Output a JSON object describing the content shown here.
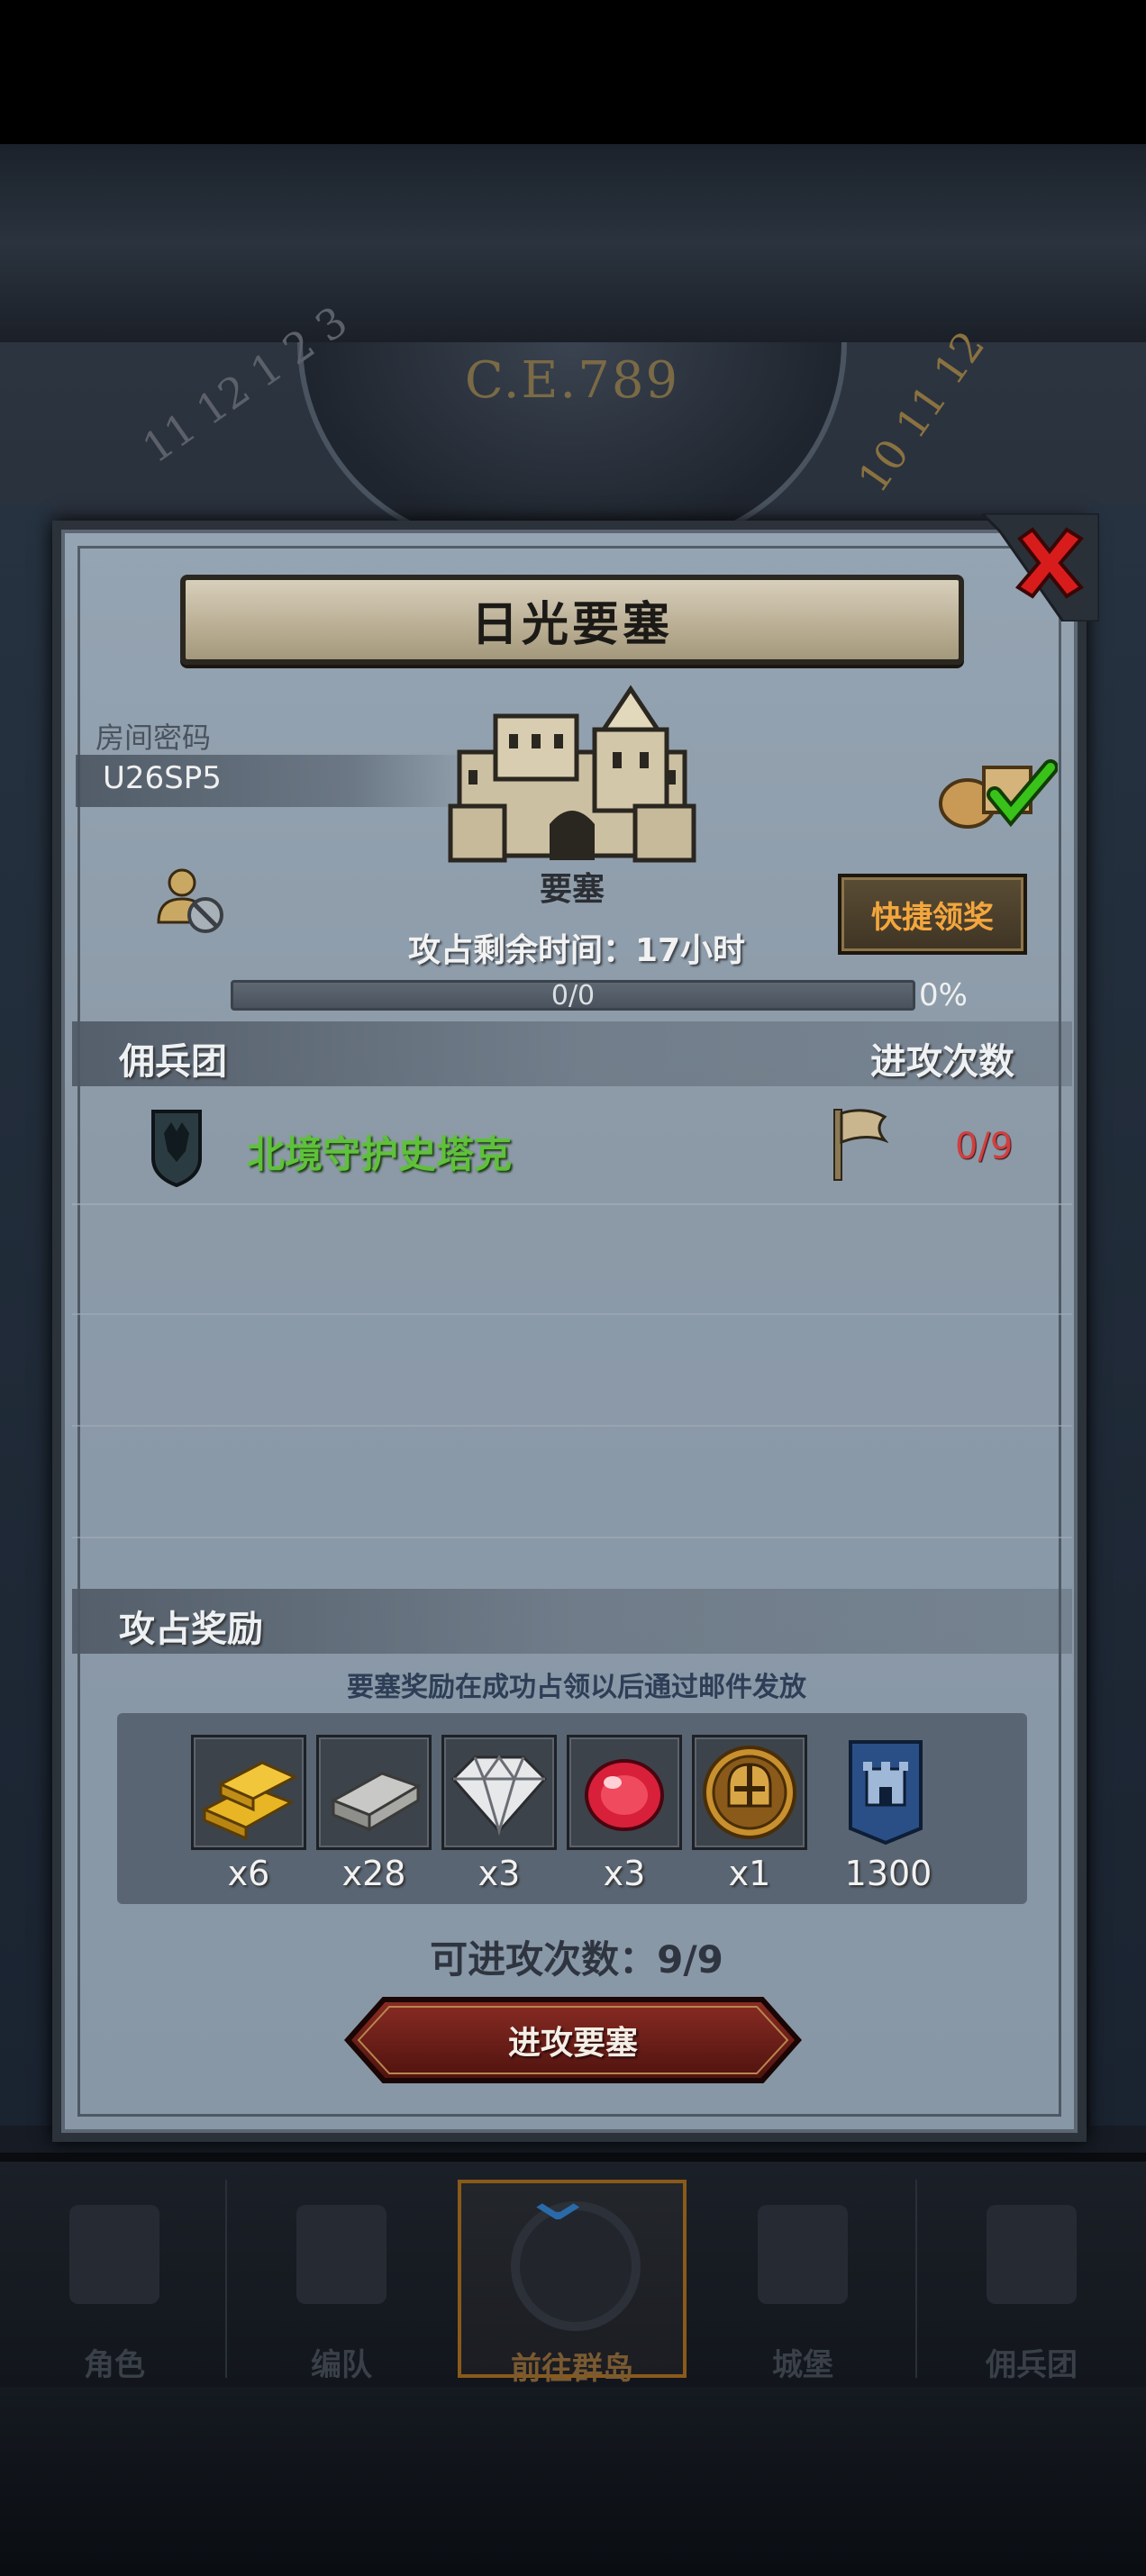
{
  "background": {
    "era_label": "C.E.789",
    "dial_left_numerals": "11 12 1 2 3",
    "dial_right_numerals": "10 11 12"
  },
  "panel": {
    "title": "日光要塞",
    "room": {
      "label": "房间密码",
      "code": "U26SP5"
    },
    "fortress_label": "要塞",
    "quick_claim_label": "快捷领奖",
    "time_remaining": "攻占剩余时间：17小时",
    "progress": {
      "text": "0/0",
      "percent_text": "0%",
      "fraction": 0
    },
    "mercenary_header": "佣兵团",
    "attempts_header": "进攻次数",
    "mercenaries": [
      {
        "name": "北境守护史塔克",
        "attempts": "0/9"
      }
    ],
    "rewards_header": "攻占奖励",
    "rewards_note": "要塞奖励在成功占领以后通过邮件发放",
    "rewards": [
      {
        "icon": "gold-bar-icon",
        "count": "x6"
      },
      {
        "icon": "iron-bar-icon",
        "count": "x28"
      },
      {
        "icon": "diamond-icon",
        "count": "x3"
      },
      {
        "icon": "ruby-icon",
        "count": "x3"
      },
      {
        "icon": "knight-medal-icon",
        "count": "x1"
      },
      {
        "icon": "fortress-banner-icon",
        "count": "1300"
      }
    ],
    "available_attempts": "可进攻次数：9/9",
    "attack_button_label": "进攻要塞",
    "colors": {
      "merc_name": "#5fc13a",
      "attempts": "#d04040",
      "quick_claim_text": "#f3a63d",
      "close": "#d81c1c"
    }
  },
  "nav": {
    "items": [
      {
        "label": "角色",
        "icon": "knight-icon"
      },
      {
        "label": "编队",
        "icon": "formation-icon"
      },
      {
        "label": "前往群岛",
        "icon": "compass-icon",
        "active": true
      },
      {
        "label": "城堡",
        "icon": "castle-icon"
      },
      {
        "label": "佣兵团",
        "icon": "mercenary-icon"
      }
    ]
  }
}
